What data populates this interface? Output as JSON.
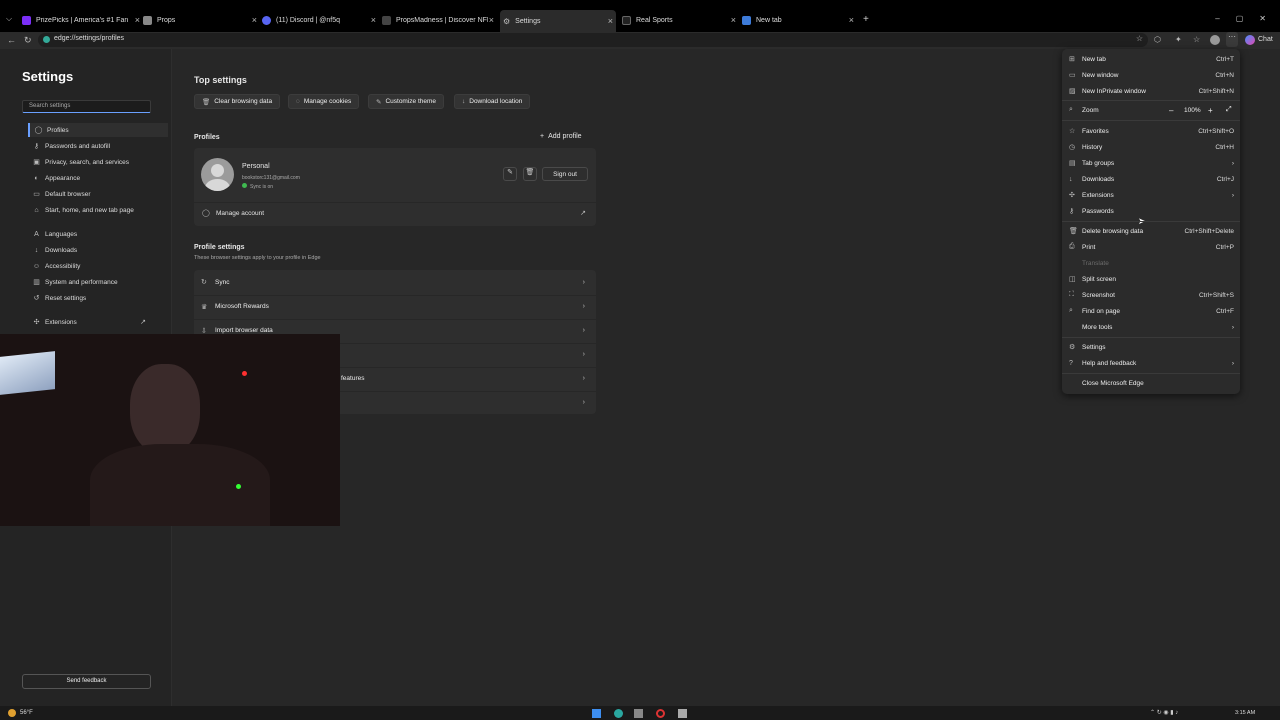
{
  "tabs": [
    {
      "label": "PrizePicks | America's #1 Fantasy S",
      "color": "#7b2ff7"
    },
    {
      "label": "Props",
      "color": "#888888"
    },
    {
      "label": "(11) Discord | @nf5q",
      "color": "#5865f2"
    },
    {
      "label": "PropsMadness | Discover NFL, WN",
      "color": "#444444"
    },
    {
      "label": "Settings",
      "color": "#888888"
    },
    {
      "label": "Real Sports",
      "color": "#222222"
    },
    {
      "label": "New tab",
      "color": "#3d7bd9"
    }
  ],
  "address": {
    "url": "edge://settings/profiles",
    "chat": "Chat"
  },
  "sidebar": {
    "title": "Settings",
    "search_placeholder": "Search settings",
    "items": [
      {
        "label": "Profiles",
        "icon": "person-icon"
      },
      {
        "label": "Passwords and autofill",
        "icon": "key-icon"
      },
      {
        "label": "Privacy, search, and services",
        "icon": "lock-icon"
      },
      {
        "label": "Appearance",
        "icon": "palette-icon"
      },
      {
        "label": "Default browser",
        "icon": "browser-icon"
      },
      {
        "label": "Start, home, and new tab page",
        "icon": "home-icon"
      },
      {
        "label": "Languages",
        "icon": "language-icon"
      },
      {
        "label": "Downloads",
        "icon": "download-icon"
      },
      {
        "label": "Accessibility",
        "icon": "accessibility-icon"
      },
      {
        "label": "System and performance",
        "icon": "system-icon"
      },
      {
        "label": "Reset settings",
        "icon": "reset-icon"
      },
      {
        "label": "Extensions",
        "icon": "puzzle-icon"
      }
    ],
    "feedback": "Send feedback"
  },
  "main": {
    "top_title": "Top settings",
    "top_buttons": [
      "Clear browsing data",
      "Manage cookies",
      "Customize theme",
      "Download location"
    ],
    "profiles_title": "Profiles",
    "add_profile": "Add profile",
    "profile": {
      "name": "Personal",
      "email": "bookstorc131@gmail.com",
      "sync": "Sync is on"
    },
    "sign_out": "Sign out",
    "manage_account": "Manage account",
    "profile_settings_title": "Profile settings",
    "profile_settings_sub": "These browser settings apply to your profile in Edge",
    "rows": [
      "Sync",
      "Microsoft Rewards",
      "Import browser data",
      "",
      "features",
      ""
    ]
  },
  "menu": {
    "items": [
      {
        "label": "New tab",
        "key": "Ctrl+T",
        "icon": "new-tab-icon"
      },
      {
        "label": "New window",
        "key": "Ctrl+N",
        "icon": "window-icon"
      },
      {
        "label": "New InPrivate window",
        "key": "Ctrl+Shift+N",
        "icon": "inprivate-icon"
      },
      {
        "label": "Zoom",
        "key": "100%",
        "icon": "zoom-icon"
      },
      {
        "label": "Favorites",
        "key": "Ctrl+Shift+O",
        "icon": "star-icon"
      },
      {
        "label": "History",
        "key": "Ctrl+H",
        "icon": "history-icon"
      },
      {
        "label": "Tab groups",
        "key": "›",
        "icon": "tab-groups-icon"
      },
      {
        "label": "Downloads",
        "key": "Ctrl+J",
        "icon": "download-icon"
      },
      {
        "label": "Extensions",
        "key": "›",
        "icon": "puzzle-icon"
      },
      {
        "label": "Passwords",
        "key": "",
        "icon": "key-icon"
      },
      {
        "label": "Delete browsing data",
        "key": "Ctrl+Shift+Delete",
        "icon": "trash-icon"
      },
      {
        "label": "Print",
        "key": "Ctrl+P",
        "icon": "print-icon"
      },
      {
        "label": "Translate",
        "key": "",
        "icon": ""
      },
      {
        "label": "Split screen",
        "key": "",
        "icon": "split-icon"
      },
      {
        "label": "Screenshot",
        "key": "Ctrl+Shift+S",
        "icon": "screenshot-icon"
      },
      {
        "label": "Find on page",
        "key": "Ctrl+F",
        "icon": "find-icon"
      },
      {
        "label": "More tools",
        "key": "›",
        "icon": ""
      },
      {
        "label": "Settings",
        "key": "",
        "icon": "gear-icon"
      },
      {
        "label": "Help and feedback",
        "key": "›",
        "icon": "help-icon"
      },
      {
        "label": "Close Microsoft Edge",
        "key": "",
        "icon": ""
      }
    ]
  },
  "taskbar": {
    "weather": "56°F",
    "time": "3:15 AM"
  }
}
